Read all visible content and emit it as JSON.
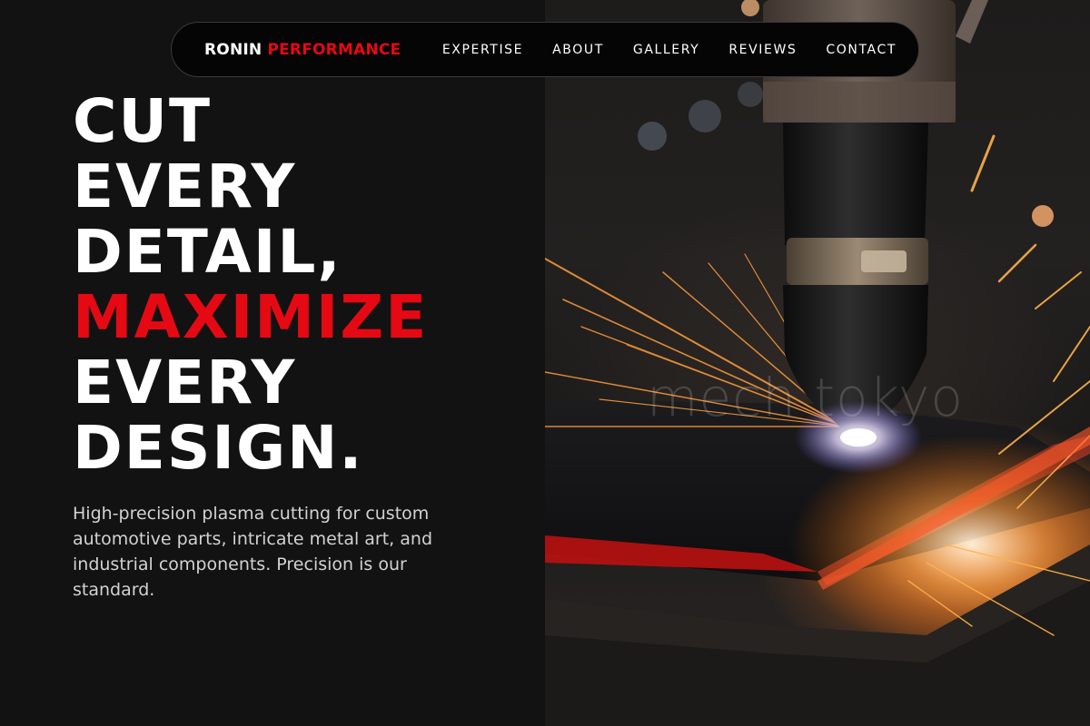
{
  "brand": {
    "name_white": "RONIN",
    "name_red": "PERFORMANCE"
  },
  "nav": {
    "items": [
      {
        "label": "EXPERTISE"
      },
      {
        "label": "ABOUT"
      },
      {
        "label": "GALLERY"
      },
      {
        "label": "REVIEWS"
      },
      {
        "label": "CONTACT"
      }
    ]
  },
  "hero": {
    "headline_lines": [
      "CUT",
      "EVERY",
      "DETAIL,",
      "MAXIMIZE",
      "EVERY",
      "DESIGN."
    ],
    "accent_line": "MAXIMIZE",
    "description": "High-precision plasma cutting for custom automotive parts, intricate metal art, and industrial components. Precision is our standard.",
    "image": {
      "subject": "plasma-cutting-torch-with-sparks",
      "watermark": "mech tokyo"
    }
  },
  "colors": {
    "accent": "#e50914",
    "background": "#121212",
    "nav_bg": "#050505",
    "text": "#ffffff",
    "muted_text": "#d2d2d2"
  }
}
